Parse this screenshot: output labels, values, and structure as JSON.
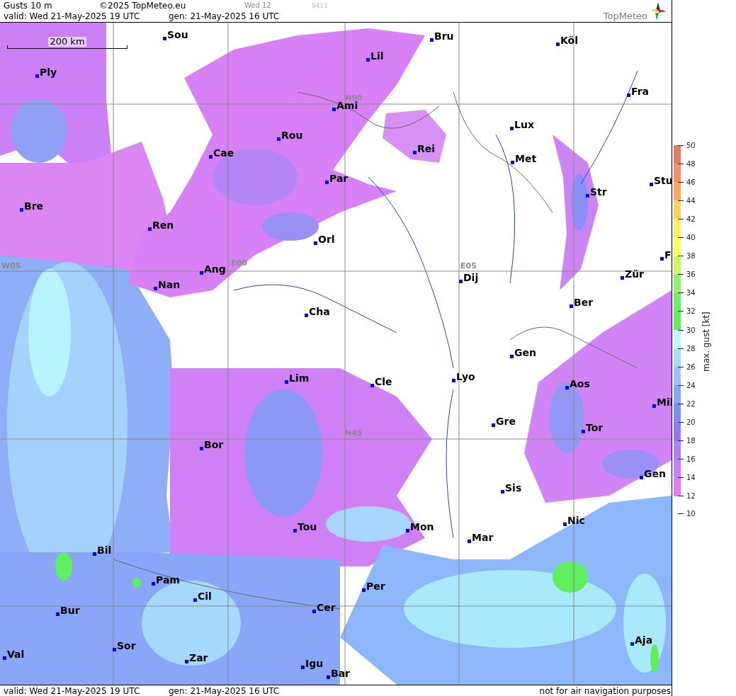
{
  "header": {
    "title": "Gusts 10 m",
    "copyright": "©2025 TopMeteo.eu",
    "day_label": "Wed 12",
    "code": "9411",
    "valid": "valid:  Wed  21-May-2025  19 UTC",
    "generated": "gen: 21-May-2025 16 UTC",
    "logo_text": "TopMeteo"
  },
  "map": {
    "scale_bar": "200 km",
    "grid_labels": [
      "N50",
      "W05",
      "E00",
      "E05",
      "N45"
    ],
    "cities": [
      {
        "name": "Sou"
      },
      {
        "name": "Lil"
      },
      {
        "name": "Bru"
      },
      {
        "name": "Köl"
      },
      {
        "name": "Ply"
      },
      {
        "name": "Ami"
      },
      {
        "name": "Fra"
      },
      {
        "name": "Lux"
      },
      {
        "name": "Rou"
      },
      {
        "name": "Rei"
      },
      {
        "name": "Cae"
      },
      {
        "name": "Met"
      },
      {
        "name": "Par"
      },
      {
        "name": "Stu"
      },
      {
        "name": "Str"
      },
      {
        "name": "Bre"
      },
      {
        "name": "Ren"
      },
      {
        "name": "Orl"
      },
      {
        "name": "F"
      },
      {
        "name": "Ang"
      },
      {
        "name": "Dij"
      },
      {
        "name": "Zür"
      },
      {
        "name": "Nan"
      },
      {
        "name": "Ber"
      },
      {
        "name": "Cha"
      },
      {
        "name": "Gen"
      },
      {
        "name": "Lim"
      },
      {
        "name": "Cle"
      },
      {
        "name": "Lyo"
      },
      {
        "name": "Aos"
      },
      {
        "name": "Mil"
      },
      {
        "name": "Gre"
      },
      {
        "name": "Tor"
      },
      {
        "name": "Bor"
      },
      {
        "name": "Gen"
      },
      {
        "name": "Sis"
      },
      {
        "name": "Nic"
      },
      {
        "name": "Tou"
      },
      {
        "name": "Mon"
      },
      {
        "name": "Mar"
      },
      {
        "name": "Bil"
      },
      {
        "name": "Pam"
      },
      {
        "name": "Cil"
      },
      {
        "name": "Per"
      },
      {
        "name": "Cer"
      },
      {
        "name": "Bur"
      },
      {
        "name": "Sor"
      },
      {
        "name": "Val"
      },
      {
        "name": "Zar"
      },
      {
        "name": "Aja"
      },
      {
        "name": "Igu"
      },
      {
        "name": "Bar"
      }
    ]
  },
  "legend": {
    "title": "max. gust [kt]",
    "ticks": [
      "50",
      "48",
      "46",
      "44",
      "42",
      "40",
      "38",
      "36",
      "34",
      "32",
      "30",
      "28",
      "26",
      "24",
      "22",
      "20",
      "18",
      "16",
      "14",
      "12",
      "10"
    ],
    "bands": [
      {
        "color": "#e67cf2"
      },
      {
        "color": "#cd80f5"
      },
      {
        "color": "#b27ef5"
      },
      {
        "color": "#9478f2"
      },
      {
        "color": "#7c8ff5"
      },
      {
        "color": "#86a6f8"
      },
      {
        "color": "#98c2fa"
      },
      {
        "color": "#a8defc"
      },
      {
        "color": "#bcf8fc"
      },
      {
        "color": "#5eee5e"
      },
      {
        "color": "#6cf06c"
      },
      {
        "color": "#92f46c"
      },
      {
        "color": "#cafa62"
      },
      {
        "color": "#ffff62"
      },
      {
        "color": "#fff262"
      },
      {
        "color": "#fdd062"
      },
      {
        "color": "#fcaa62"
      },
      {
        "color": "#f68e66"
      },
      {
        "color": "#e67a66"
      }
    ]
  },
  "footer": {
    "valid": "valid:  Wed  21-May-2025  19 UTC",
    "generated": "gen: 21-May-2025 16 UTC",
    "disclaimer": "not for air navigation purposes"
  }
}
